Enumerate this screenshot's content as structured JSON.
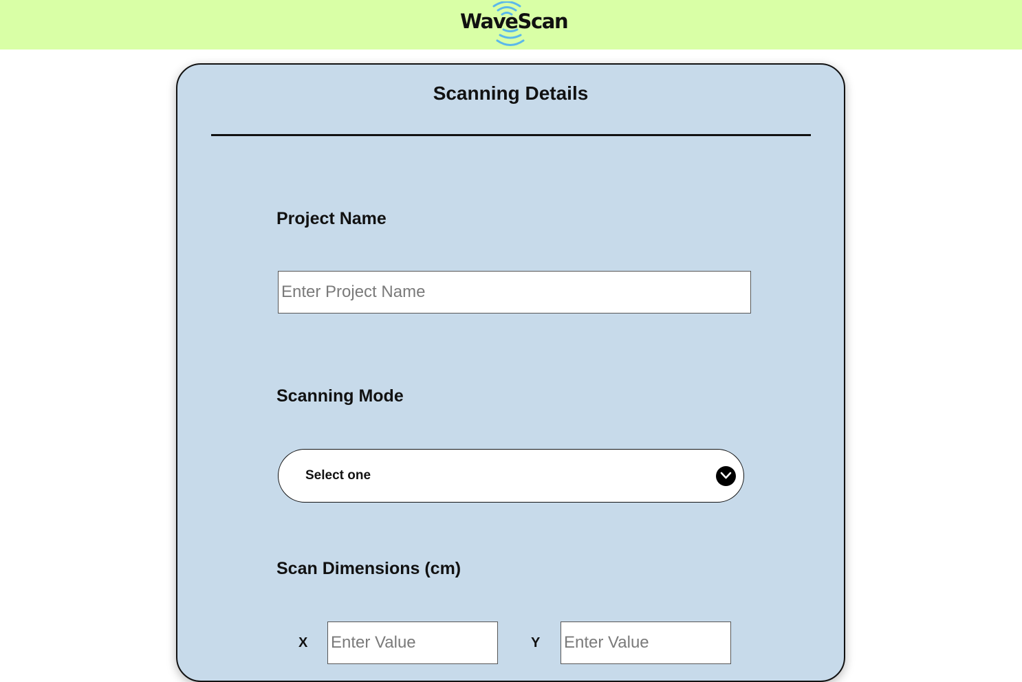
{
  "brand": {
    "name": "WaveScan",
    "accent_color": "#5bb8ea",
    "header_color": "#d9ffa6"
  },
  "card": {
    "title": "Scanning Details",
    "background_color": "#c7daea"
  },
  "project_name": {
    "label": "Project Name",
    "placeholder": "Enter Project Name",
    "value": ""
  },
  "scanning_mode": {
    "label": "Scanning Mode",
    "selected": "Select one",
    "icon": "chevron-down-icon"
  },
  "scan_dimensions": {
    "label": "Scan Dimensions (cm)",
    "x": {
      "label": "X",
      "placeholder": "Enter Value",
      "value": ""
    },
    "y": {
      "label": "Y",
      "placeholder": "Enter Value",
      "value": ""
    }
  }
}
